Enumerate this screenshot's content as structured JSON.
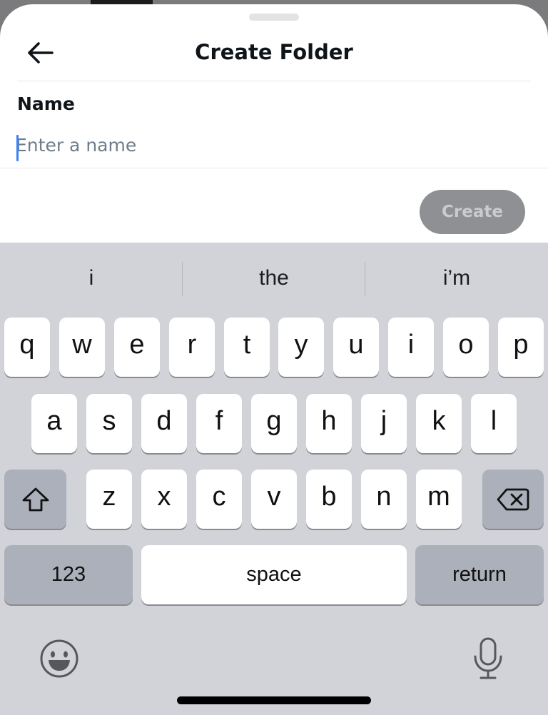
{
  "header": {
    "title": "Create Folder",
    "back_icon": "arrow-left-icon"
  },
  "form": {
    "name_label": "Name",
    "name_placeholder": "Enter a name",
    "name_value": ""
  },
  "actions": {
    "create_label": "Create"
  },
  "keyboard": {
    "suggestions": [
      "i",
      "the",
      "i’m"
    ],
    "row1": [
      "q",
      "w",
      "e",
      "r",
      "t",
      "y",
      "u",
      "i",
      "o",
      "p"
    ],
    "row2": [
      "a",
      "s",
      "d",
      "f",
      "g",
      "h",
      "j",
      "k",
      "l"
    ],
    "row3": [
      "z",
      "x",
      "c",
      "v",
      "b",
      "n",
      "m"
    ],
    "shift_icon": "shift-icon",
    "delete_icon": "delete-backspace-icon",
    "numbers_label": "123",
    "space_label": "space",
    "return_label": "return",
    "emoji_icon": "emoji-icon",
    "mic_icon": "microphone-icon"
  },
  "colors": {
    "create_disabled_bg": "#8e9093",
    "keyboard_bg": "#d1d3d9",
    "caret": "#3a82f7"
  }
}
